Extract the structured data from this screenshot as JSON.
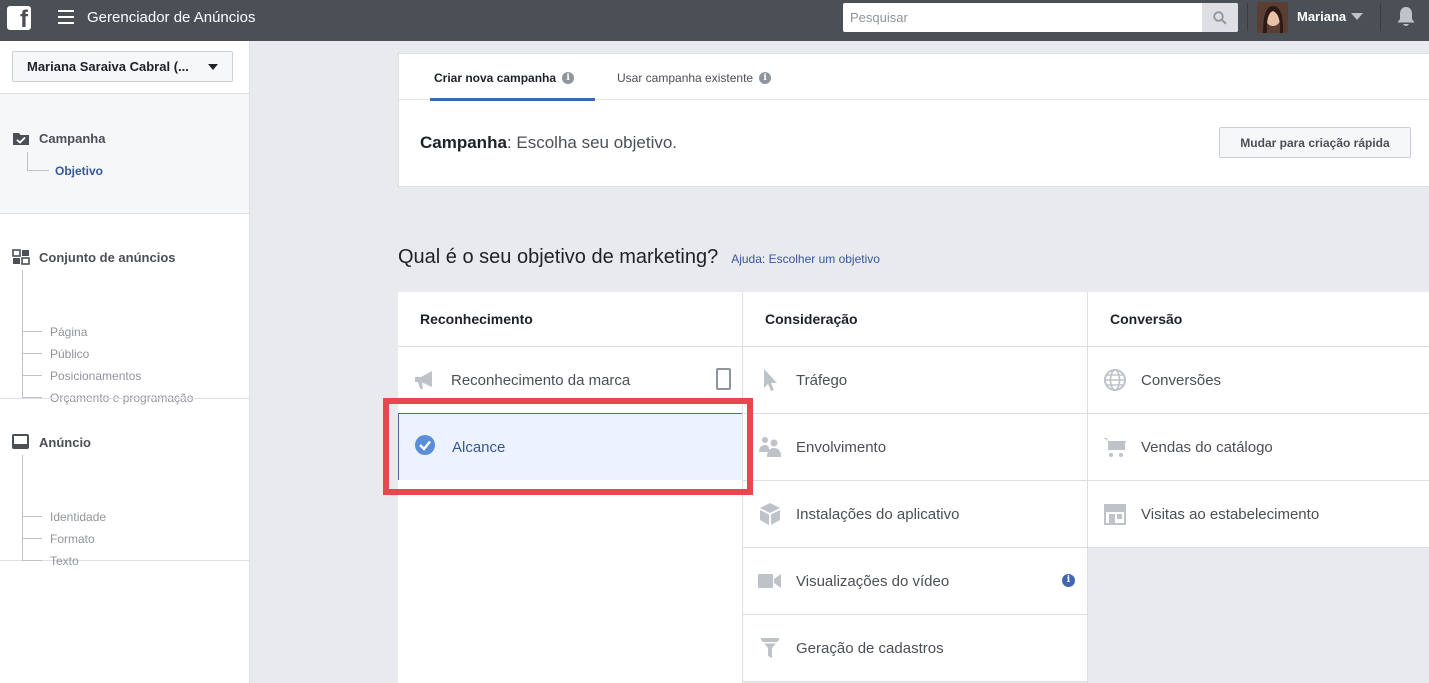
{
  "topbar": {
    "logo": "f",
    "title": "Gerenciador de Anúncios",
    "search_placeholder": "Pesquisar",
    "user_name": "Mariana"
  },
  "sidebar": {
    "account": "Mariana Saraiva Cabral (...",
    "campanha": {
      "label": "Campanha",
      "items": [
        "Objetivo"
      ]
    },
    "conjunto": {
      "label": "Conjunto de anúncios",
      "items": [
        "Página",
        "Público",
        "Posicionamentos",
        "Orçamento e programação"
      ]
    },
    "anuncio": {
      "label": "Anúncio",
      "items": [
        "Identidade",
        "Formato",
        "Texto"
      ]
    }
  },
  "header": {
    "tabs": [
      {
        "label": "Criar nova campanha",
        "active": true
      },
      {
        "label": "Usar campanha existente",
        "active": false
      }
    ],
    "campanha_label": "Campanha",
    "campanha_text": ": Escolha seu objetivo.",
    "quick_button": "Mudar para criação rápida"
  },
  "question": {
    "text": "Qual é o seu objetivo de marketing?",
    "help": "Ajuda: Escolher um objetivo"
  },
  "objectives": {
    "columns": [
      {
        "title": "Reconhecimento",
        "items": [
          {
            "label": "Reconhecimento da marca",
            "icon": "megaphone-icon"
          },
          {
            "label": "Alcance",
            "icon": "checkmark-icon",
            "selected": true
          }
        ]
      },
      {
        "title": "Consideração",
        "items": [
          {
            "label": "Tráfego",
            "icon": "cursor-icon"
          },
          {
            "label": "Envolvimento",
            "icon": "people-icon"
          },
          {
            "label": "Instalações do aplicativo",
            "icon": "box-icon"
          },
          {
            "label": "Visualizações do vídeo",
            "icon": "video-camera-icon"
          },
          {
            "label": "Geração de cadastros",
            "icon": "funnel-icon"
          }
        ]
      },
      {
        "title": "Conversão",
        "items": [
          {
            "label": "Conversões",
            "icon": "globe-icon"
          },
          {
            "label": "Vendas do catálogo",
            "icon": "cart-icon"
          },
          {
            "label": "Visitas ao estabelecimento",
            "icon": "store-icon"
          }
        ]
      }
    ]
  },
  "colors": {
    "topbar": "#4b4f56",
    "accent": "#4267b2",
    "highlight": "#e8474e",
    "selected_bg": "#ecf3ff"
  }
}
